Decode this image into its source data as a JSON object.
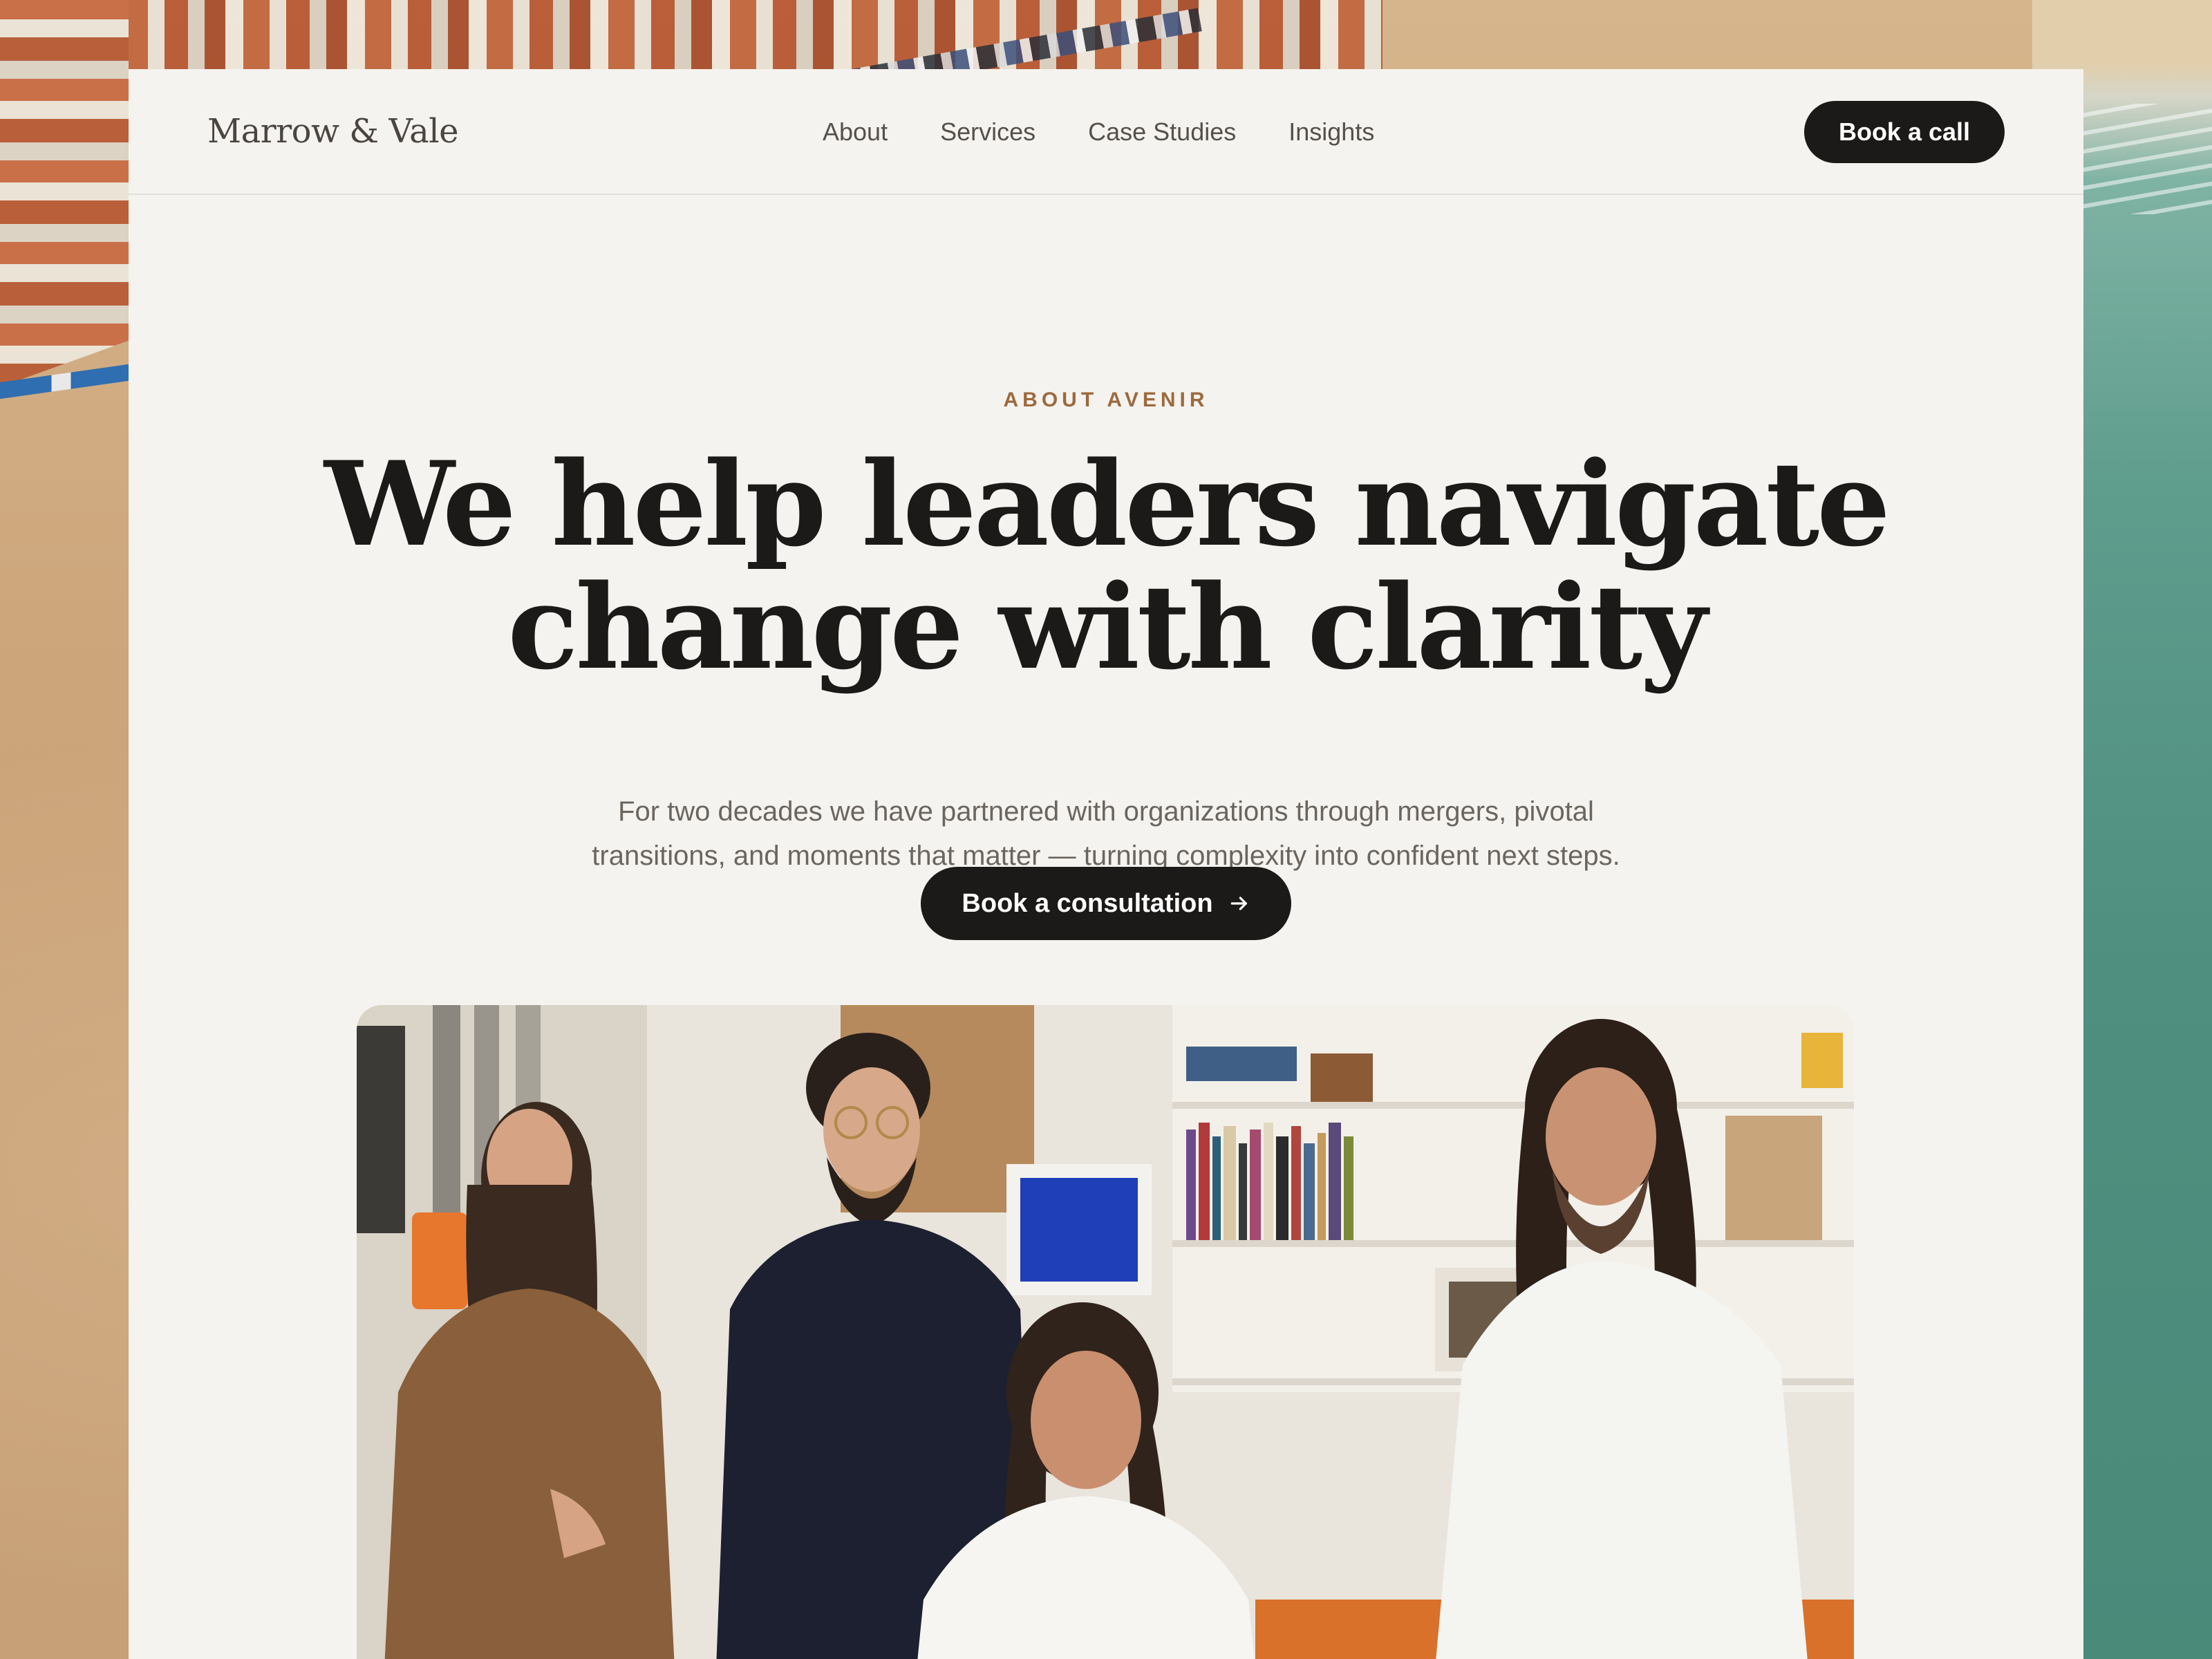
{
  "nav": {
    "logo": "Marrow & Vale",
    "links": [
      "About",
      "Services",
      "Case Studies",
      "Insights"
    ],
    "cta": "Book a call"
  },
  "hero": {
    "eyebrow": "ABOUT AVENIR",
    "headline_line1": "We help leaders navigate",
    "headline_line2": "change with clarity",
    "subtext_line1": "For two decades we have partnered with organizations through mergers, pivotal",
    "subtext_line2": "transitions, and moments that matter — turning complexity into confident next steps.",
    "cta": "Book a consultation",
    "cta_icon": "arrow-right-icon"
  },
  "colors": {
    "page_bg": "#f5f3ef",
    "ink": "#1c1a18",
    "accent": "#9c6a3e",
    "body_text": "#6b655f"
  }
}
